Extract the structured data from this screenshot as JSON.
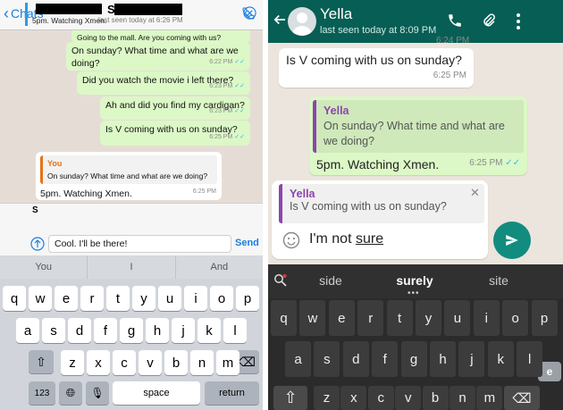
{
  "ios": {
    "back_label": "Chats",
    "contact_initial": "S",
    "last_seen": "last seen today at 6:26 PM",
    "messages": [
      {
        "text": "Going to the mall. Are you coming with us?"
      },
      {
        "text": "On sunday? What time and what are we doing?",
        "time": "6:22 PM"
      },
      {
        "text": "Did you watch the movie i left there?",
        "time": "6:23 PM"
      },
      {
        "text": "Ah and did you find my cardigan?",
        "time": "6:23 PM"
      },
      {
        "text": "Is V coming with us on sunday?",
        "time": "6:25 PM"
      }
    ],
    "reply_bubble": {
      "quote_name": "You",
      "quote_text": "On sunday? What time and what are we doing?",
      "text": "5pm. Watching Xmen.",
      "time": "6:25 PM"
    },
    "reply_preview": {
      "initial": "S",
      "text": "5pm. Watching Xmen."
    },
    "input_value": "Cool. I'll be there!",
    "send_label": "Send",
    "predictions": [
      "You",
      "I",
      "And"
    ],
    "keys_row1": [
      "q",
      "w",
      "e",
      "r",
      "t",
      "y",
      "u",
      "i",
      "o",
      "p"
    ],
    "keys_row2": [
      "a",
      "s",
      "d",
      "f",
      "g",
      "h",
      "j",
      "k",
      "l"
    ],
    "keys_row3": [
      "z",
      "x",
      "c",
      "v",
      "b",
      "n",
      "m"
    ],
    "key_123": "123",
    "key_space": "space",
    "key_return": "return"
  },
  "android": {
    "contact_name": "Yella",
    "last_seen": "last seen today at 8:09 PM",
    "top_time": "6:24 PM",
    "message_in": {
      "text": "Is V coming with us on sunday?",
      "time": "6:25 PM"
    },
    "message_out": {
      "quote_name": "Yella",
      "quote_text": "On sunday? What time and what are we doing?",
      "text": "5pm. Watching Xmen.",
      "time": "6:25 PM"
    },
    "compose": {
      "quote_name": "Yella",
      "quote_text": "Is V coming with us on sunday?",
      "input_value_plain": "I'm not ",
      "input_value_underlined": "sure"
    },
    "suggestions": [
      "side",
      "surely",
      "site"
    ],
    "keys_row1": [
      "q",
      "w",
      "e",
      "r",
      "t",
      "y",
      "u",
      "i",
      "o",
      "p"
    ],
    "keys_row2": [
      "a",
      "s",
      "d",
      "f",
      "g",
      "h",
      "j",
      "k",
      "l"
    ],
    "keys_row3": [
      "z",
      "x",
      "c",
      "v",
      "b",
      "n",
      "m"
    ],
    "watermark": "engadget"
  },
  "colors": {
    "ios_blue": "#1a7ee0",
    "whatsapp_green": "#075e54",
    "send_green": "#128c7e",
    "bubble_out": "#dcf8c6",
    "quote_purple": "#8e44ad",
    "quote_orange": "#e6711b"
  }
}
